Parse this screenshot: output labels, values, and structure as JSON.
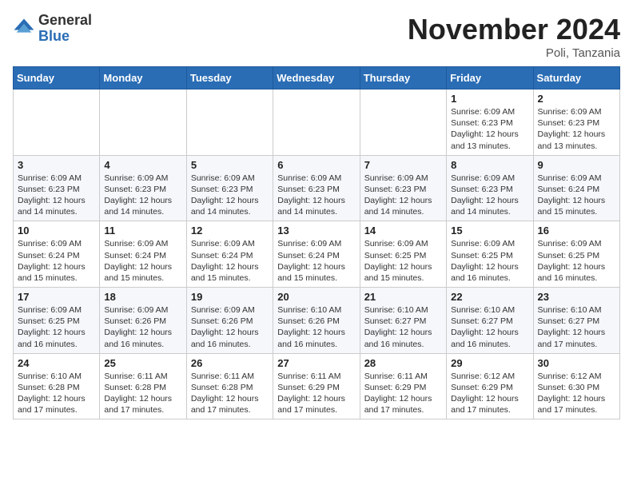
{
  "header": {
    "logo_general": "General",
    "logo_blue": "Blue",
    "month_year": "November 2024",
    "location": "Poli, Tanzania"
  },
  "days_of_week": [
    "Sunday",
    "Monday",
    "Tuesday",
    "Wednesday",
    "Thursday",
    "Friday",
    "Saturday"
  ],
  "weeks": [
    [
      {
        "day": "",
        "info": ""
      },
      {
        "day": "",
        "info": ""
      },
      {
        "day": "",
        "info": ""
      },
      {
        "day": "",
        "info": ""
      },
      {
        "day": "",
        "info": ""
      },
      {
        "day": "1",
        "info": "Sunrise: 6:09 AM\nSunset: 6:23 PM\nDaylight: 12 hours\nand 13 minutes."
      },
      {
        "day": "2",
        "info": "Sunrise: 6:09 AM\nSunset: 6:23 PM\nDaylight: 12 hours\nand 13 minutes."
      }
    ],
    [
      {
        "day": "3",
        "info": "Sunrise: 6:09 AM\nSunset: 6:23 PM\nDaylight: 12 hours\nand 14 minutes."
      },
      {
        "day": "4",
        "info": "Sunrise: 6:09 AM\nSunset: 6:23 PM\nDaylight: 12 hours\nand 14 minutes."
      },
      {
        "day": "5",
        "info": "Sunrise: 6:09 AM\nSunset: 6:23 PM\nDaylight: 12 hours\nand 14 minutes."
      },
      {
        "day": "6",
        "info": "Sunrise: 6:09 AM\nSunset: 6:23 PM\nDaylight: 12 hours\nand 14 minutes."
      },
      {
        "day": "7",
        "info": "Sunrise: 6:09 AM\nSunset: 6:23 PM\nDaylight: 12 hours\nand 14 minutes."
      },
      {
        "day": "8",
        "info": "Sunrise: 6:09 AM\nSunset: 6:23 PM\nDaylight: 12 hours\nand 14 minutes."
      },
      {
        "day": "9",
        "info": "Sunrise: 6:09 AM\nSunset: 6:24 PM\nDaylight: 12 hours\nand 15 minutes."
      }
    ],
    [
      {
        "day": "10",
        "info": "Sunrise: 6:09 AM\nSunset: 6:24 PM\nDaylight: 12 hours\nand 15 minutes."
      },
      {
        "day": "11",
        "info": "Sunrise: 6:09 AM\nSunset: 6:24 PM\nDaylight: 12 hours\nand 15 minutes."
      },
      {
        "day": "12",
        "info": "Sunrise: 6:09 AM\nSunset: 6:24 PM\nDaylight: 12 hours\nand 15 minutes."
      },
      {
        "day": "13",
        "info": "Sunrise: 6:09 AM\nSunset: 6:24 PM\nDaylight: 12 hours\nand 15 minutes."
      },
      {
        "day": "14",
        "info": "Sunrise: 6:09 AM\nSunset: 6:25 PM\nDaylight: 12 hours\nand 15 minutes."
      },
      {
        "day": "15",
        "info": "Sunrise: 6:09 AM\nSunset: 6:25 PM\nDaylight: 12 hours\nand 16 minutes."
      },
      {
        "day": "16",
        "info": "Sunrise: 6:09 AM\nSunset: 6:25 PM\nDaylight: 12 hours\nand 16 minutes."
      }
    ],
    [
      {
        "day": "17",
        "info": "Sunrise: 6:09 AM\nSunset: 6:25 PM\nDaylight: 12 hours\nand 16 minutes."
      },
      {
        "day": "18",
        "info": "Sunrise: 6:09 AM\nSunset: 6:26 PM\nDaylight: 12 hours\nand 16 minutes."
      },
      {
        "day": "19",
        "info": "Sunrise: 6:09 AM\nSunset: 6:26 PM\nDaylight: 12 hours\nand 16 minutes."
      },
      {
        "day": "20",
        "info": "Sunrise: 6:10 AM\nSunset: 6:26 PM\nDaylight: 12 hours\nand 16 minutes."
      },
      {
        "day": "21",
        "info": "Sunrise: 6:10 AM\nSunset: 6:27 PM\nDaylight: 12 hours\nand 16 minutes."
      },
      {
        "day": "22",
        "info": "Sunrise: 6:10 AM\nSunset: 6:27 PM\nDaylight: 12 hours\nand 16 minutes."
      },
      {
        "day": "23",
        "info": "Sunrise: 6:10 AM\nSunset: 6:27 PM\nDaylight: 12 hours\nand 17 minutes."
      }
    ],
    [
      {
        "day": "24",
        "info": "Sunrise: 6:10 AM\nSunset: 6:28 PM\nDaylight: 12 hours\nand 17 minutes."
      },
      {
        "day": "25",
        "info": "Sunrise: 6:11 AM\nSunset: 6:28 PM\nDaylight: 12 hours\nand 17 minutes."
      },
      {
        "day": "26",
        "info": "Sunrise: 6:11 AM\nSunset: 6:28 PM\nDaylight: 12 hours\nand 17 minutes."
      },
      {
        "day": "27",
        "info": "Sunrise: 6:11 AM\nSunset: 6:29 PM\nDaylight: 12 hours\nand 17 minutes."
      },
      {
        "day": "28",
        "info": "Sunrise: 6:11 AM\nSunset: 6:29 PM\nDaylight: 12 hours\nand 17 minutes."
      },
      {
        "day": "29",
        "info": "Sunrise: 6:12 AM\nSunset: 6:29 PM\nDaylight: 12 hours\nand 17 minutes."
      },
      {
        "day": "30",
        "info": "Sunrise: 6:12 AM\nSunset: 6:30 PM\nDaylight: 12 hours\nand 17 minutes."
      }
    ]
  ]
}
